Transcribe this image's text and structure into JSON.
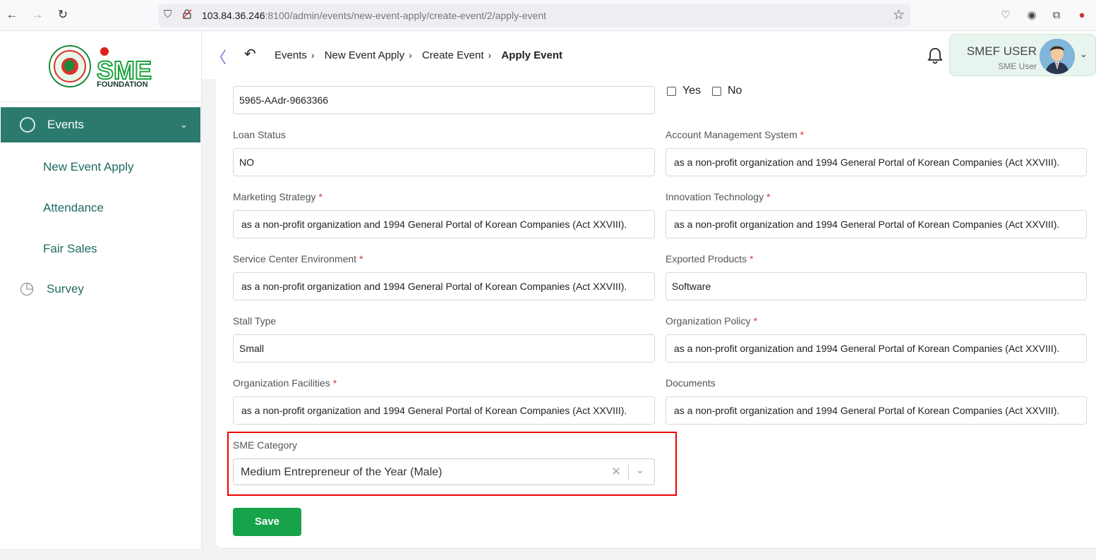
{
  "browser": {
    "url_host": "103.84.36.246",
    "url_rest": ":8100/admin/events/new-event-apply/create-event/2/apply-event"
  },
  "sidebar": {
    "logo_text": "SME",
    "logo_sub": "FOUNDATION",
    "items": [
      {
        "label": "Events"
      },
      {
        "label": "New Event Apply"
      },
      {
        "label": "Attendance"
      },
      {
        "label": "Fair Sales"
      },
      {
        "label": "Survey"
      }
    ]
  },
  "header": {
    "breadcrumb": [
      "Events",
      "New Event Apply",
      "Create Event",
      "Apply Event"
    ],
    "user_name": "SMEF USER",
    "user_role": "SME User"
  },
  "form": {
    "top_input": "5965-AAdr-9663366",
    "yes_label": "Yes",
    "no_label": "No",
    "loan_status_label": "Loan Status",
    "loan_status_value": "NO",
    "account_mgmt_label": "Account Management System",
    "account_mgmt_value": "as a non-profit organization and 1994 General Portal of Korean Companies (Act XXVIII).",
    "marketing_label": "Marketing Strategy",
    "marketing_value": "as a non-profit organization and 1994 General Portal of Korean Companies (Act XXVIII).",
    "innovation_label": "Innovation Technology",
    "innovation_value": "as a non-profit organization and 1994 General Portal of Korean Companies (Act XXVIII).",
    "service_label": "Service Center Environment",
    "service_value": "as a non-profit organization and 1994 General Portal of Korean Companies (Act XXVIII).",
    "exported_label": "Exported Products",
    "exported_value": "Software",
    "stall_label": "Stall Type",
    "stall_value": "Small",
    "policy_label": "Organization Policy",
    "policy_value": "as a non-profit organization and 1994 General Portal of Korean Companies (Act XXVIII).",
    "facilities_label": "Organization Facilities",
    "facilities_value": "as a non-profit organization and 1994 General Portal of Korean Companies (Act XXVIII).",
    "documents_label": "Documents",
    "documents_value": "as a non-profit organization and 1994 General Portal of Korean Companies (Act XXVIII).",
    "sme_category_label": "SME Category",
    "sme_category_value": "Medium Entrepreneur of the Year (Male)",
    "required_mark": "*",
    "save_label": "Save"
  }
}
